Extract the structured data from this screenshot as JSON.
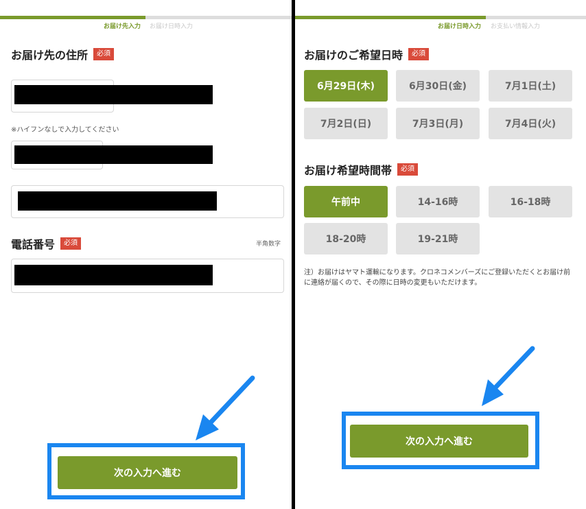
{
  "left_panel": {
    "progress": {
      "fraction": 0.5,
      "current_step": "お届け先入力",
      "next_step": "お届け日時入力"
    },
    "address_section": {
      "title": "お届け先の住所",
      "required_badge": "必須"
    },
    "postal_note": "※ハイフンなしで入力してください",
    "phone_section": {
      "title": "電話番号",
      "required_badge": "必須",
      "hint": "半角数字"
    },
    "next_button": "次の入力へ進む"
  },
  "right_panel": {
    "progress": {
      "fraction": 0.65,
      "current_step": "お届け日時入力",
      "next_step": "お支払い情報入力"
    },
    "date_section": {
      "title": "お届けのご希望日時",
      "required_badge": "必須"
    },
    "dates": [
      {
        "label": "6月29日(木)",
        "selected": true
      },
      {
        "label": "6月30日(金)",
        "selected": false
      },
      {
        "label": "7月1日(土)",
        "selected": false
      },
      {
        "label": "7月2日(日)",
        "selected": false
      },
      {
        "label": "7月3日(月)",
        "selected": false
      },
      {
        "label": "7月4日(火)",
        "selected": false
      }
    ],
    "time_section": {
      "title": "お届け希望時間帯",
      "required_badge": "必須"
    },
    "times": [
      {
        "label": "午前中",
        "selected": true
      },
      {
        "label": "14-16時",
        "selected": false
      },
      {
        "label": "16-18時",
        "selected": false
      },
      {
        "label": "18-20時",
        "selected": false
      },
      {
        "label": "19-21時",
        "selected": false
      }
    ],
    "disclaimer": "注）お届けはヤマト運輸になります。クロネコメンバーズにご登録いただくとお届け前に連絡が届くので、その際に日時の変更もいただけます。",
    "next_button": "次の入力へ進む"
  },
  "colors": {
    "accent": "#7a9a2c",
    "required": "#d94a3a",
    "highlight": "#1a86f0"
  }
}
